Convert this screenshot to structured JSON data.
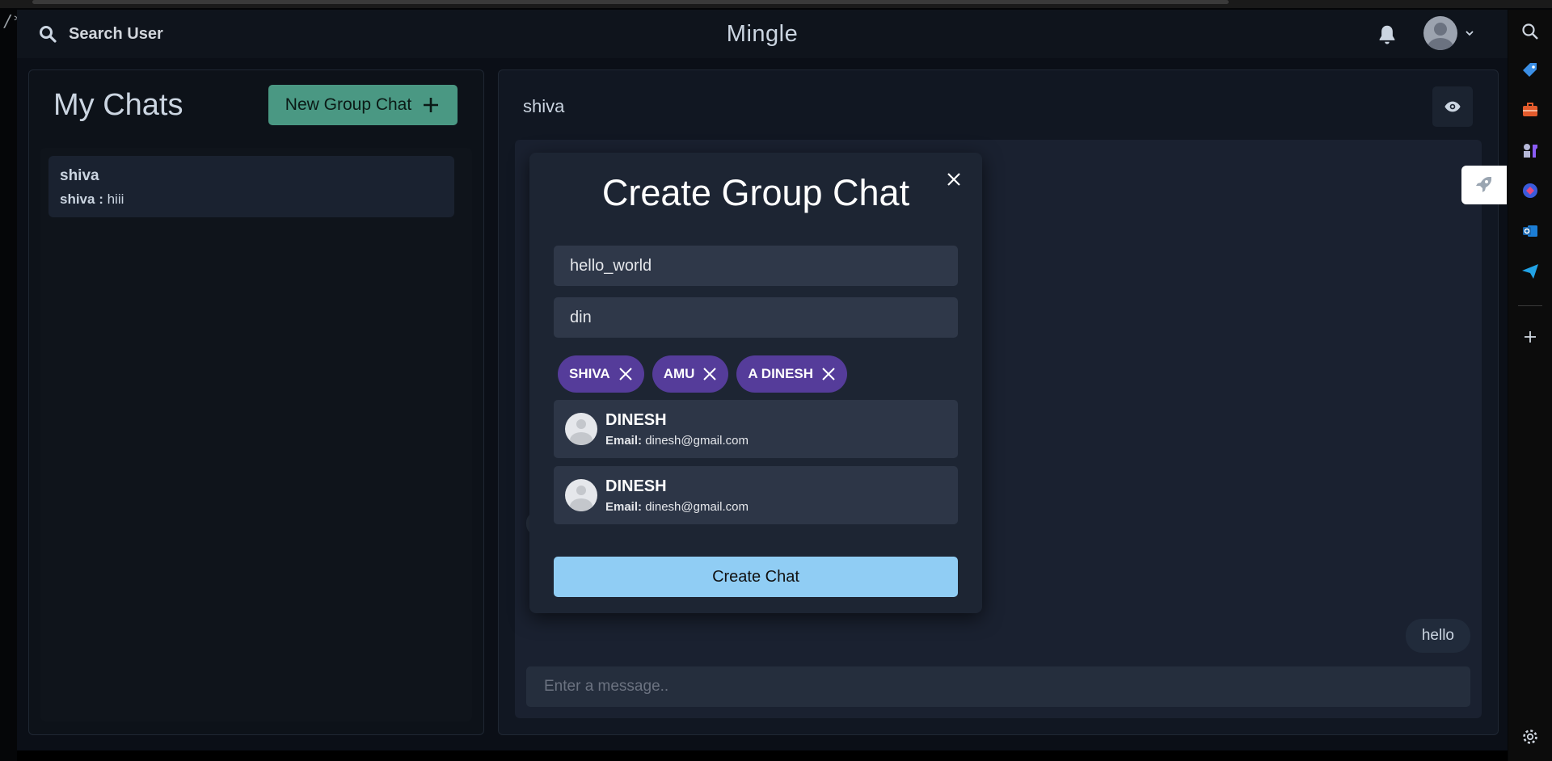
{
  "app": {
    "brand": "Mingle",
    "search_label": "Search User"
  },
  "sidebar": {
    "title": "My Chats",
    "new_group_label": "New Group Chat",
    "chats": [
      {
        "name": "shiva",
        "sender": "shiva :",
        "last_message": "hiii"
      }
    ]
  },
  "chat": {
    "header_name": "shiva",
    "messages": [
      {
        "text": "hello",
        "own": true
      }
    ],
    "input_placeholder": "Enter a message.."
  },
  "modal": {
    "title": "Create Group Chat",
    "group_name_value": "hello_world",
    "search_value": "din",
    "selected_users": [
      "SHIVA",
      "AMU",
      "A DINESH"
    ],
    "results": [
      {
        "name": "DINESH",
        "email_label": "Email:",
        "email": "dinesh@gmail.com"
      },
      {
        "name": "DINESH",
        "email_label": "Email:",
        "email": "dinesh@gmail.com"
      }
    ],
    "create_label": "Create Chat"
  },
  "colors": {
    "accent_teal": "#4a9883",
    "chip_purple": "#553c9a",
    "create_button": "#90cdf4"
  },
  "icons": [
    "search-icon",
    "bell-icon",
    "avatar-icon",
    "chevron-down-icon",
    "plus-icon",
    "eye-icon",
    "close-icon",
    "rocket-icon",
    "settings-icon"
  ]
}
